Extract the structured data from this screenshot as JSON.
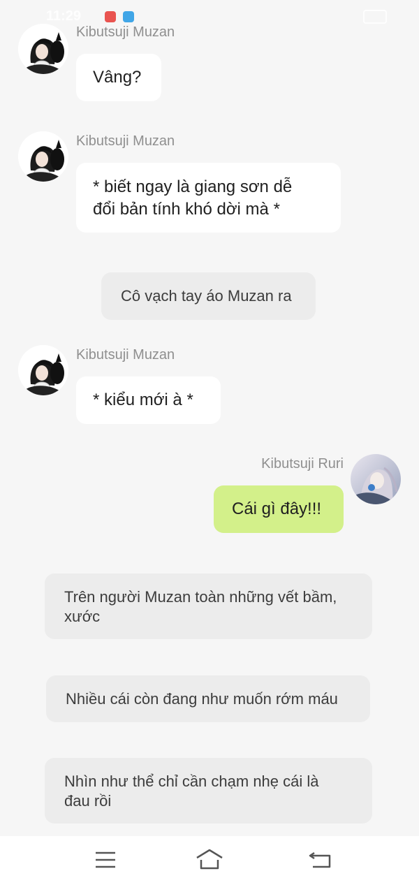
{
  "status_bar": {
    "time": "11:29",
    "icons": [
      "messenger-icon",
      "manga-toon-icon",
      "novel-toon-icon",
      "sim-icon",
      "battery-icon",
      "charging-icon"
    ]
  },
  "messages": [
    {
      "speaker": "Kibutsuji Muzan",
      "text": "Vâng?"
    },
    {
      "speaker": "Kibutsuji Muzan",
      "text_lines": [
        "* biết ngay là giang sơn dễ",
        "đổi bản tính khó dời mà *"
      ]
    },
    {
      "narration": "Cô vạch tay áo Muzan ra"
    },
    {
      "speaker": "Kibutsuji Muzan",
      "text": "* kiểu mới à *"
    },
    {
      "speaker": "Kibutsuji Ruri",
      "text": "Cái gì đây!!!"
    },
    {
      "narration_lines": [
        "Trên người Muzan toàn những vết bầm,",
        "xước"
      ]
    },
    {
      "narration": "Nhiều cái còn đang như muốn rớm máu"
    },
    {
      "narration_lines": [
        "Nhìn như thể chỉ cần chạm nhẹ cái là",
        "đau rồi"
      ]
    }
  ],
  "colors": {
    "background": "#f6f6f6",
    "bubble_other": "#ffffff",
    "bubble_self": "#d3f08a",
    "narration_bg": "#ececec",
    "name_text": "#8f8f8f"
  },
  "navigation": {
    "icons": [
      "menu-icon",
      "home-icon",
      "back-icon"
    ]
  }
}
